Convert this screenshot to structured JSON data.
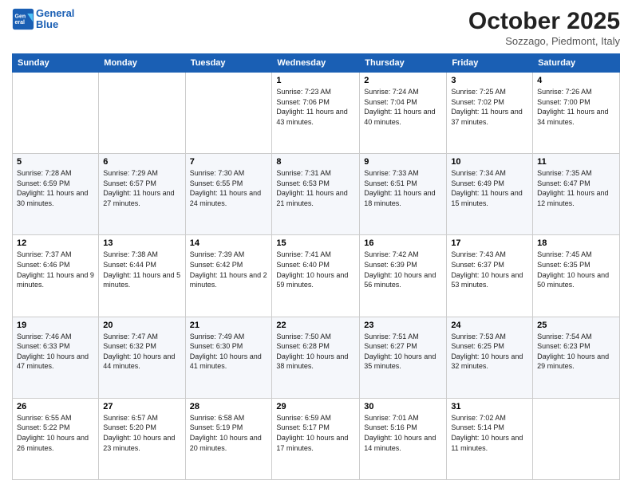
{
  "header": {
    "logo_line1": "General",
    "logo_line2": "Blue",
    "month": "October 2025",
    "location": "Sozzago, Piedmont, Italy"
  },
  "days_of_week": [
    "Sunday",
    "Monday",
    "Tuesday",
    "Wednesday",
    "Thursday",
    "Friday",
    "Saturday"
  ],
  "weeks": [
    [
      {
        "day": "",
        "sunrise": "",
        "sunset": "",
        "daylight": ""
      },
      {
        "day": "",
        "sunrise": "",
        "sunset": "",
        "daylight": ""
      },
      {
        "day": "",
        "sunrise": "",
        "sunset": "",
        "daylight": ""
      },
      {
        "day": "1",
        "sunrise": "Sunrise: 7:23 AM",
        "sunset": "Sunset: 7:06 PM",
        "daylight": "Daylight: 11 hours and 43 minutes."
      },
      {
        "day": "2",
        "sunrise": "Sunrise: 7:24 AM",
        "sunset": "Sunset: 7:04 PM",
        "daylight": "Daylight: 11 hours and 40 minutes."
      },
      {
        "day": "3",
        "sunrise": "Sunrise: 7:25 AM",
        "sunset": "Sunset: 7:02 PM",
        "daylight": "Daylight: 11 hours and 37 minutes."
      },
      {
        "day": "4",
        "sunrise": "Sunrise: 7:26 AM",
        "sunset": "Sunset: 7:00 PM",
        "daylight": "Daylight: 11 hours and 34 minutes."
      }
    ],
    [
      {
        "day": "5",
        "sunrise": "Sunrise: 7:28 AM",
        "sunset": "Sunset: 6:59 PM",
        "daylight": "Daylight: 11 hours and 30 minutes."
      },
      {
        "day": "6",
        "sunrise": "Sunrise: 7:29 AM",
        "sunset": "Sunset: 6:57 PM",
        "daylight": "Daylight: 11 hours and 27 minutes."
      },
      {
        "day": "7",
        "sunrise": "Sunrise: 7:30 AM",
        "sunset": "Sunset: 6:55 PM",
        "daylight": "Daylight: 11 hours and 24 minutes."
      },
      {
        "day": "8",
        "sunrise": "Sunrise: 7:31 AM",
        "sunset": "Sunset: 6:53 PM",
        "daylight": "Daylight: 11 hours and 21 minutes."
      },
      {
        "day": "9",
        "sunrise": "Sunrise: 7:33 AM",
        "sunset": "Sunset: 6:51 PM",
        "daylight": "Daylight: 11 hours and 18 minutes."
      },
      {
        "day": "10",
        "sunrise": "Sunrise: 7:34 AM",
        "sunset": "Sunset: 6:49 PM",
        "daylight": "Daylight: 11 hours and 15 minutes."
      },
      {
        "day": "11",
        "sunrise": "Sunrise: 7:35 AM",
        "sunset": "Sunset: 6:47 PM",
        "daylight": "Daylight: 11 hours and 12 minutes."
      }
    ],
    [
      {
        "day": "12",
        "sunrise": "Sunrise: 7:37 AM",
        "sunset": "Sunset: 6:46 PM",
        "daylight": "Daylight: 11 hours and 9 minutes."
      },
      {
        "day": "13",
        "sunrise": "Sunrise: 7:38 AM",
        "sunset": "Sunset: 6:44 PM",
        "daylight": "Daylight: 11 hours and 5 minutes."
      },
      {
        "day": "14",
        "sunrise": "Sunrise: 7:39 AM",
        "sunset": "Sunset: 6:42 PM",
        "daylight": "Daylight: 11 hours and 2 minutes."
      },
      {
        "day": "15",
        "sunrise": "Sunrise: 7:41 AM",
        "sunset": "Sunset: 6:40 PM",
        "daylight": "Daylight: 10 hours and 59 minutes."
      },
      {
        "day": "16",
        "sunrise": "Sunrise: 7:42 AM",
        "sunset": "Sunset: 6:39 PM",
        "daylight": "Daylight: 10 hours and 56 minutes."
      },
      {
        "day": "17",
        "sunrise": "Sunrise: 7:43 AM",
        "sunset": "Sunset: 6:37 PM",
        "daylight": "Daylight: 10 hours and 53 minutes."
      },
      {
        "day": "18",
        "sunrise": "Sunrise: 7:45 AM",
        "sunset": "Sunset: 6:35 PM",
        "daylight": "Daylight: 10 hours and 50 minutes."
      }
    ],
    [
      {
        "day": "19",
        "sunrise": "Sunrise: 7:46 AM",
        "sunset": "Sunset: 6:33 PM",
        "daylight": "Daylight: 10 hours and 47 minutes."
      },
      {
        "day": "20",
        "sunrise": "Sunrise: 7:47 AM",
        "sunset": "Sunset: 6:32 PM",
        "daylight": "Daylight: 10 hours and 44 minutes."
      },
      {
        "day": "21",
        "sunrise": "Sunrise: 7:49 AM",
        "sunset": "Sunset: 6:30 PM",
        "daylight": "Daylight: 10 hours and 41 minutes."
      },
      {
        "day": "22",
        "sunrise": "Sunrise: 7:50 AM",
        "sunset": "Sunset: 6:28 PM",
        "daylight": "Daylight: 10 hours and 38 minutes."
      },
      {
        "day": "23",
        "sunrise": "Sunrise: 7:51 AM",
        "sunset": "Sunset: 6:27 PM",
        "daylight": "Daylight: 10 hours and 35 minutes."
      },
      {
        "day": "24",
        "sunrise": "Sunrise: 7:53 AM",
        "sunset": "Sunset: 6:25 PM",
        "daylight": "Daylight: 10 hours and 32 minutes."
      },
      {
        "day": "25",
        "sunrise": "Sunrise: 7:54 AM",
        "sunset": "Sunset: 6:23 PM",
        "daylight": "Daylight: 10 hours and 29 minutes."
      }
    ],
    [
      {
        "day": "26",
        "sunrise": "Sunrise: 6:55 AM",
        "sunset": "Sunset: 5:22 PM",
        "daylight": "Daylight: 10 hours and 26 minutes."
      },
      {
        "day": "27",
        "sunrise": "Sunrise: 6:57 AM",
        "sunset": "Sunset: 5:20 PM",
        "daylight": "Daylight: 10 hours and 23 minutes."
      },
      {
        "day": "28",
        "sunrise": "Sunrise: 6:58 AM",
        "sunset": "Sunset: 5:19 PM",
        "daylight": "Daylight: 10 hours and 20 minutes."
      },
      {
        "day": "29",
        "sunrise": "Sunrise: 6:59 AM",
        "sunset": "Sunset: 5:17 PM",
        "daylight": "Daylight: 10 hours and 17 minutes."
      },
      {
        "day": "30",
        "sunrise": "Sunrise: 7:01 AM",
        "sunset": "Sunset: 5:16 PM",
        "daylight": "Daylight: 10 hours and 14 minutes."
      },
      {
        "day": "31",
        "sunrise": "Sunrise: 7:02 AM",
        "sunset": "Sunset: 5:14 PM",
        "daylight": "Daylight: 10 hours and 11 minutes."
      },
      {
        "day": "",
        "sunrise": "",
        "sunset": "",
        "daylight": ""
      }
    ]
  ]
}
